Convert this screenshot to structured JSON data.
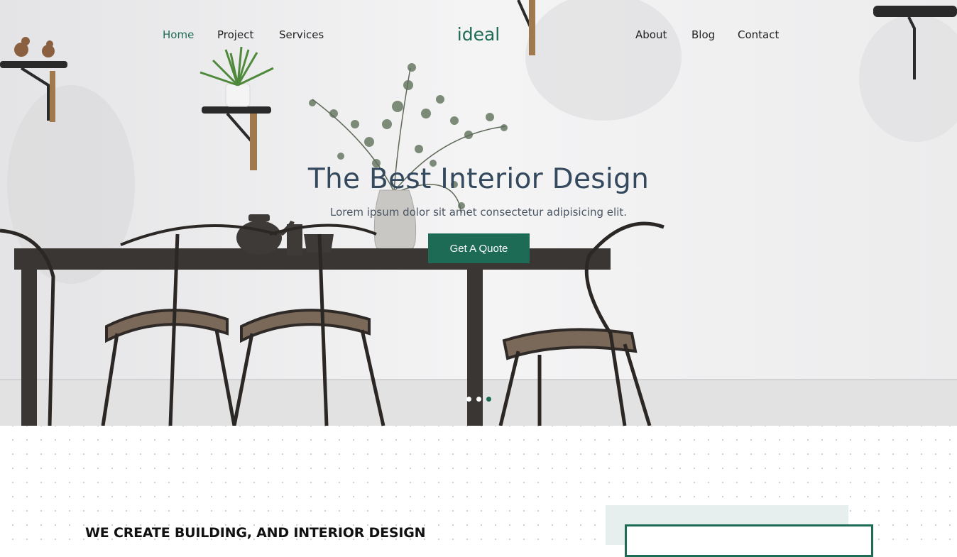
{
  "nav": {
    "left": [
      "Home",
      "Project",
      "Services"
    ],
    "logo": "ideal",
    "right": [
      "About",
      "Blog",
      "Contact"
    ],
    "active": "Home"
  },
  "hero": {
    "title": "The Best Interior Design",
    "subtitle": "Lorem ipsum dolor sit amet consectetur adipisicing elit.",
    "cta": "Get A Quote",
    "slides": 3,
    "active_slide": 3
  },
  "about": {
    "heading": "WE CREATE BUILDING, AND INTERIOR DESIGN"
  },
  "colors": {
    "accent": "#1e6b55",
    "text_dark": "#34495e",
    "panel_bg": "#e6efed"
  }
}
